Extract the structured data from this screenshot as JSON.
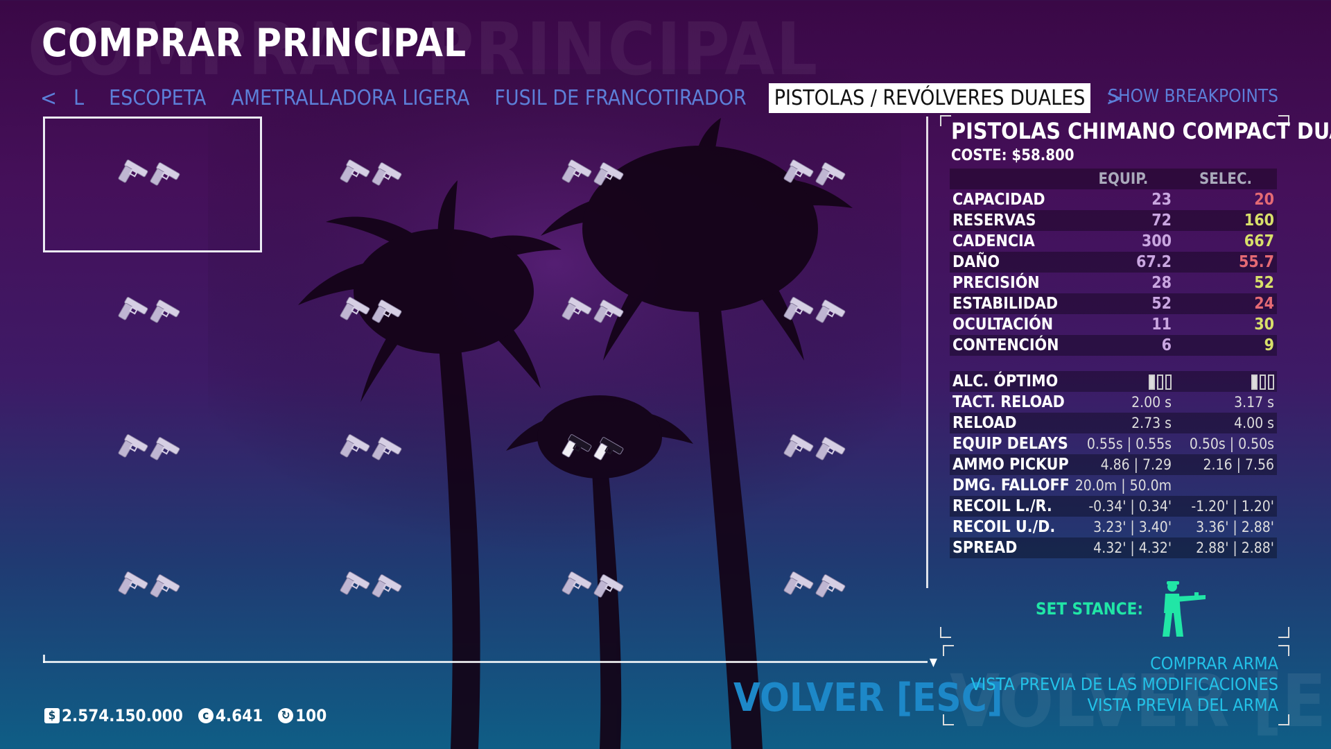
{
  "header": {
    "title": "COMPRAR PRINCIPAL",
    "ghost_title": "COMPRAR PRINCIPAL"
  },
  "tabs": {
    "prev_arrow": "<",
    "next_arrow": ">",
    "items": [
      {
        "label": "L"
      },
      {
        "label": "ESCOPETA"
      },
      {
        "label": "AMETRALLADORA LIGERA"
      },
      {
        "label": "FUSIL DE FRANCOTIRADOR"
      },
      {
        "label": "PISTOLAS / REVÓLVERES DUALES",
        "active": true
      }
    ],
    "show_breakpoints": "SHOW BREAKPOINTS"
  },
  "weapon_grid": {
    "rows": 4,
    "cols": 4,
    "selected_index": 0,
    "items": [
      {
        "icon": "dual-pistol-icon"
      },
      {
        "icon": "dual-pistol-icon"
      },
      {
        "icon": "dual-pistol-icon"
      },
      {
        "icon": "dual-pistol-icon"
      },
      {
        "icon": "dual-pistol-icon"
      },
      {
        "icon": "dual-pistol-icon"
      },
      {
        "icon": "dual-pistol-icon"
      },
      {
        "icon": "dual-pistol-icon"
      },
      {
        "icon": "dual-pistol-icon"
      },
      {
        "icon": "dual-pistol-icon"
      },
      {
        "icon": "dual-revolver-icon"
      },
      {
        "icon": "dual-pistol-icon"
      },
      {
        "icon": "dual-pistol-icon"
      },
      {
        "icon": "dual-pistol-icon"
      },
      {
        "icon": "dual-pistol-icon"
      },
      {
        "icon": "dual-pistol-icon"
      }
    ]
  },
  "details": {
    "weapon_name": "PISTOLAS CHIMANO COMPACT DUALES",
    "cost": "COSTE: $58.800",
    "col_equip": "EQUIP.",
    "col_selec": "SELEC.",
    "stats": [
      {
        "label": "CAPACIDAD",
        "equip": "23",
        "selec": "20",
        "trend": "down"
      },
      {
        "label": "RESERVAS",
        "equip": "72",
        "selec": "160",
        "trend": "up"
      },
      {
        "label": "CADENCIA",
        "equip": "300",
        "selec": "667",
        "trend": "up"
      },
      {
        "label": "DAÑO",
        "equip": "67.2",
        "selec": "55.7",
        "trend": "down"
      },
      {
        "label": "PRECISIÓN",
        "equip": "28",
        "selec": "52",
        "trend": "up"
      },
      {
        "label": "ESTABILIDAD",
        "equip": "52",
        "selec": "24",
        "trend": "down"
      },
      {
        "label": "OCULTACIÓN",
        "equip": "11",
        "selec": "30",
        "trend": "up"
      },
      {
        "label": "CONTENCIÓN",
        "equip": "6",
        "selec": "9",
        "trend": "up"
      }
    ],
    "optimal_range": {
      "label": "ALC. ÓPTIMO",
      "equip_level": 1,
      "selec_level": 1,
      "max": 3
    },
    "extra": [
      {
        "label": "TACT. RELOAD",
        "equip": "2.00 s",
        "selec": "3.17 s"
      },
      {
        "label": "RELOAD",
        "equip": "2.73 s",
        "selec": "4.00 s"
      },
      {
        "label": "EQUIP DELAYS",
        "equip": "0.55s | 0.55s",
        "selec": "0.50s | 0.50s"
      },
      {
        "label": "AMMO PICKUP",
        "equip": "4.86 | 7.29",
        "selec": "2.16 | 7.56"
      },
      {
        "label": "DMG. FALLOFF",
        "equip": "20.0m | 50.0m",
        "selec": ""
      },
      {
        "label": "RECOIL L./R.",
        "equip": "-0.34' | 0.34'",
        "selec": "-1.20' | 1.20'"
      },
      {
        "label": "RECOIL U./D.",
        "equip": "3.23' | 3.40'",
        "selec": "3.36' | 2.88'"
      },
      {
        "label": "SPREAD",
        "equip": "4.32' | 4.32'",
        "selec": "2.88' | 2.88'"
      }
    ],
    "set_stance": "SET STANCE:"
  },
  "actions": {
    "buy": "COMPRAR ARMA",
    "preview_mods": "VISTA PREVIA DE LAS MODIFICACIONES",
    "preview_weapon": "VISTA PREVIA DEL ARMA",
    "back": "VOLVER [ESC]",
    "back_ghost": "VOLVER [ESC]"
  },
  "footer": {
    "money": "2.574.150.000",
    "money_icon": "$",
    "coins": "4.641",
    "coins_icon": "coin-icon",
    "level": "100",
    "level_icon": "infamy-icon"
  },
  "colors": {
    "accent_blue": "#5c7fd8",
    "stat_up": "#d8e06a",
    "stat_down": "#e56a74",
    "stance_green": "#21e6a6",
    "action_cyan": "#23c2e8"
  }
}
